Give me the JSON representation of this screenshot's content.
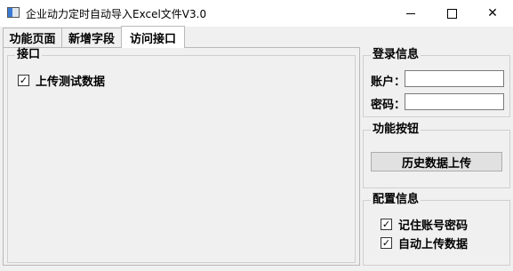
{
  "window": {
    "title": "企业动力定时自动导入Excel文件V3.0",
    "close_glyph": "✕"
  },
  "tabs": [
    {
      "label": "功能页面"
    },
    {
      "label": "新增字段"
    },
    {
      "label": "访问接口",
      "active": true
    }
  ],
  "interface_panel": {
    "group_title": "接口",
    "upload_test_data": {
      "label": "上传测试数据",
      "checked": true
    }
  },
  "login": {
    "group_title": "登录信息",
    "account_label": "账户：",
    "account_value": "",
    "password_label": "密码：",
    "password_value": ""
  },
  "function_buttons": {
    "group_title": "功能按钮",
    "history_upload_label": "历史数据上传"
  },
  "config": {
    "group_title": "配置信息",
    "remember_password": {
      "label": "记住账号密码",
      "checked": true
    },
    "auto_upload": {
      "label": "自动上传数据",
      "checked": true
    }
  },
  "check_glyph": "✓"
}
